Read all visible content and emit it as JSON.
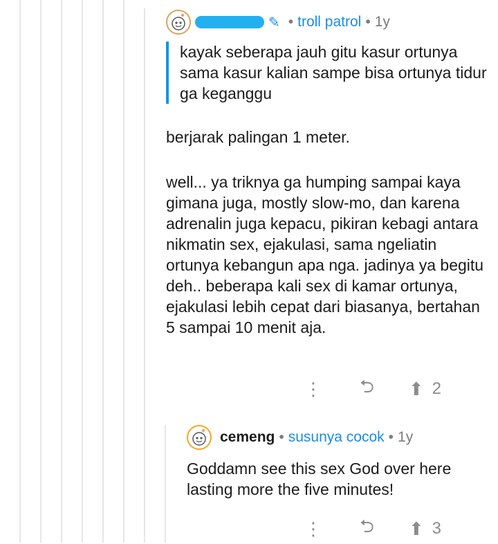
{
  "thread_lines_count": 7,
  "comment1": {
    "author_redacted": true,
    "mod_icon": "mod-shield-icon",
    "flair": "troll patrol",
    "age": "1y",
    "quote": "kayak seberapa jauh gitu kasur ortunya sama kasur kalian sampe bisa ortunya tidur ga keganggu",
    "para1": "berjarak palingan 1 meter.",
    "para2": "well... ya triknya ga humping sampai kaya gimana juga, mostly slow-mo, dan karena adrenalin juga kepacu, pikiran kebagi antara nikmatin sex, ejakulasi, sama ngeliatin ortunya kebangun apa nga. jadinya ya begitu deh.. beberapa kali sex di kamar ortunya, ejakulasi lebih cepat dari biasanya, bertahan 5 sampai 10 menit aja.",
    "score": "2"
  },
  "comment2": {
    "author": "cemeng",
    "flair": "susunya cocok",
    "age": "1y",
    "body": "Goddamn see this sex God over here lasting more the five minutes!",
    "score": "3"
  },
  "icons": {
    "more": "more-vertical-icon",
    "reply": "reply-arrow-icon",
    "upvote": "upvote-arrow-icon"
  },
  "colors": {
    "accent": "#1a8de0",
    "quote_bar": "#0f96e9",
    "thread": "#e6e6e6",
    "muted": "#7c7c7c"
  }
}
